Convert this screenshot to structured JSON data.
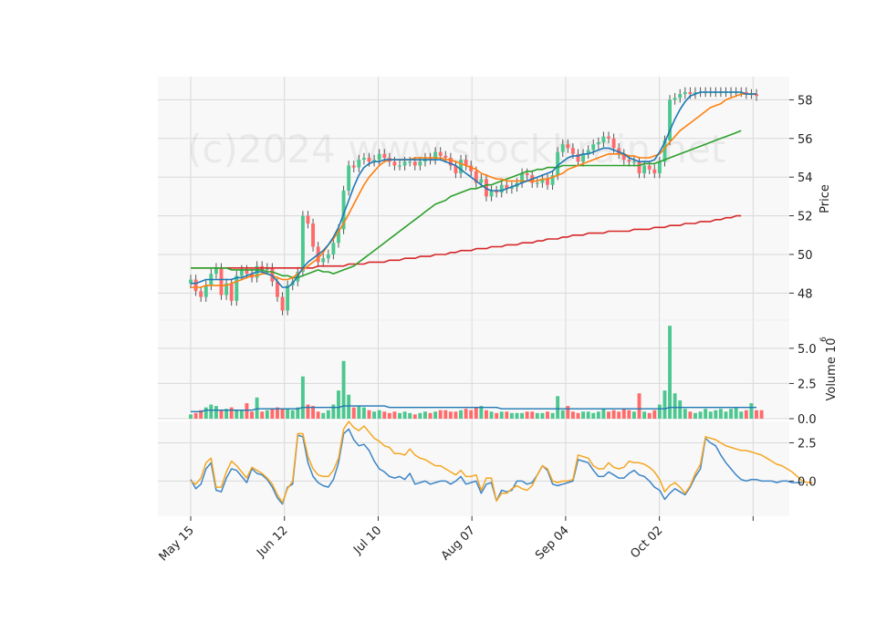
{
  "watermark": "(c)2024 www.stockbrain.net",
  "colors": {
    "up": "#26a69a",
    "up_fill": "#4dc790",
    "down": "#e8474b",
    "down_fill": "#ff6b6b",
    "ma_fast": "#1f77b4",
    "ma_mid": "#ff7f0e",
    "ma_slow": "#2ca02c",
    "ma_long": "#d62728",
    "vol_ma": "#1f77b4",
    "osc_a": "#3d85c6",
    "osc_b": "#f5a623",
    "panel_bg": "#f8f8f8",
    "grid": "#d9d9d9"
  },
  "chart_data": [
    {
      "type": "candlestick",
      "ylabel": "Price",
      "ylim": [
        46.6,
        59.2
      ],
      "yticks": [
        "48",
        "50",
        "52",
        "54",
        "56",
        "58"
      ],
      "ytick_values": [
        48,
        50,
        52,
        54,
        56,
        58
      ],
      "x_start": "2023-05-15",
      "x_end": "2023-10-31",
      "xtick_labels": [
        "May 15",
        "Jun 12",
        "Jul 10",
        "Aug 07",
        "Sep 04",
        "Oct 02"
      ],
      "xtick_dates": [
        "2023-05-15",
        "2023-06-12",
        "2023-07-10",
        "2023-08-07",
        "2023-09-04",
        "2023-10-02",
        "2023-10-30"
      ],
      "close": [
        48.7,
        48.1,
        47.8,
        48.4,
        49.0,
        49.3,
        47.9,
        48.5,
        47.6,
        48.9,
        49.2,
        49.0,
        48.8,
        49.4,
        49.2,
        49.3,
        48.6,
        47.8,
        47.1,
        48.4,
        48.6,
        49.1,
        52.0,
        51.6,
        50.4,
        49.6,
        49.8,
        50.0,
        50.6,
        51.3,
        53.3,
        54.6,
        54.5,
        54.9,
        55.0,
        54.8,
        54.9,
        55.2,
        55.0,
        54.8,
        54.6,
        54.6,
        54.8,
        54.8,
        54.6,
        54.8,
        55.0,
        54.9,
        55.3,
        55.1,
        55.0,
        54.6,
        54.2,
        54.9,
        54.6,
        54.3,
        53.7,
        53.9,
        53.0,
        53.3,
        53.2,
        53.6,
        53.4,
        53.5,
        53.7,
        54.2,
        54.1,
        53.7,
        53.7,
        53.9,
        53.6,
        54.1,
        55.3,
        55.7,
        55.5,
        55.2,
        54.8,
        55.2,
        55.4,
        55.7,
        55.8,
        56.1,
        56.0,
        55.5,
        55.2,
        54.9,
        54.8,
        54.8,
        54.2,
        54.6,
        54.4,
        54.2,
        54.8,
        55.9,
        58.0,
        58.1,
        58.3,
        58.4,
        58.3,
        58.4,
        58.4,
        58.4,
        58.4,
        58.4,
        58.4,
        58.4,
        58.4,
        58.4,
        58.4,
        58.3,
        58.3,
        58.2
      ],
      "ma_fast": [
        48.5,
        48.5,
        48.6,
        48.7,
        48.7,
        48.7,
        48.7,
        48.7,
        48.7,
        48.8,
        48.8,
        48.9,
        49.0,
        49.1,
        49.1,
        49.0,
        48.9,
        48.6,
        48.3,
        48.3,
        48.5,
        48.9,
        49.3,
        49.6,
        49.8,
        50.0,
        50.2,
        50.5,
        50.9,
        51.4,
        52.1,
        52.8,
        53.5,
        54.1,
        54.5,
        54.7,
        54.8,
        54.8,
        54.9,
        54.9,
        54.9,
        54.9,
        54.9,
        54.9,
        54.9,
        54.9,
        54.9,
        54.9,
        54.9,
        54.9,
        54.8,
        54.7,
        54.6,
        54.4,
        54.2,
        54.0,
        53.8,
        53.6,
        53.4,
        53.3,
        53.3,
        53.3,
        53.4,
        53.5,
        53.6,
        53.7,
        53.8,
        53.9,
        54.0,
        54.1,
        54.2,
        54.3,
        54.6,
        54.8,
        55.0,
        55.1,
        55.1,
        55.2,
        55.2,
        55.3,
        55.4,
        55.5,
        55.5,
        55.4,
        55.3,
        55.2,
        55.0,
        54.9,
        54.8,
        54.8,
        54.8,
        54.9,
        55.3,
        55.8,
        56.4,
        57.0,
        57.5,
        57.9,
        58.2,
        58.3,
        58.4,
        58.4,
        58.4,
        58.4,
        58.4,
        58.4,
        58.4,
        58.4,
        58.4,
        58.3,
        58.3,
        58.3
      ],
      "ma_mid": [
        48.3,
        48.3,
        48.3,
        48.4,
        48.4,
        48.4,
        48.4,
        48.4,
        48.5,
        48.6,
        48.7,
        48.8,
        48.9,
        48.9,
        49.0,
        49.0,
        48.9,
        48.8,
        48.7,
        48.7,
        48.8,
        49.0,
        49.2,
        49.4,
        49.6,
        49.8,
        50.1,
        50.5,
        50.8,
        51.2,
        51.6,
        52.1,
        52.6,
        53.1,
        53.6,
        54.0,
        54.3,
        54.6,
        54.8,
        54.9,
        54.9,
        54.9,
        54.9,
        54.9,
        55.0,
        55.0,
        55.0,
        55.0,
        55.0,
        55.0,
        54.9,
        54.9,
        54.8,
        54.7,
        54.6,
        54.5,
        54.4,
        54.2,
        54.1,
        54.0,
        53.9,
        53.9,
        53.8,
        53.8,
        53.8,
        53.8,
        53.8,
        53.8,
        53.8,
        53.9,
        53.9,
        54.0,
        54.1,
        54.2,
        54.4,
        54.5,
        54.6,
        54.7,
        54.8,
        54.9,
        55.0,
        55.1,
        55.2,
        55.2,
        55.2,
        55.2,
        55.1,
        55.1,
        55.0,
        55.0,
        55.0,
        55.1,
        55.2,
        55.5,
        55.8,
        56.1,
        56.4,
        56.6,
        56.8,
        57.0,
        57.2,
        57.4,
        57.6,
        57.7,
        57.8,
        58.0,
        58.1,
        58.2,
        58.3,
        58.3,
        58.3,
        58.3
      ],
      "ma_slow": [
        49.3,
        49.3,
        49.3,
        49.3,
        49.3,
        49.3,
        49.3,
        49.3,
        49.2,
        49.2,
        49.2,
        49.2,
        49.2,
        49.2,
        49.2,
        49.1,
        49.1,
        49.0,
        48.9,
        48.9,
        48.8,
        48.8,
        48.9,
        49.0,
        49.1,
        49.2,
        49.1,
        49.1,
        49.0,
        49.1,
        49.2,
        49.3,
        49.4,
        49.6,
        49.8,
        50.0,
        50.2,
        50.4,
        50.6,
        50.8,
        51.0,
        51.2,
        51.4,
        51.6,
        51.8,
        52.0,
        52.2,
        52.4,
        52.6,
        52.7,
        52.8,
        53.0,
        53.1,
        53.2,
        53.3,
        53.4,
        53.4,
        53.5,
        53.6,
        53.6,
        53.7,
        53.8,
        53.9,
        54.0,
        54.1,
        54.2,
        54.3,
        54.3,
        54.4,
        54.4,
        54.5,
        54.5,
        54.5,
        54.6,
        54.6,
        54.6,
        54.6,
        54.6,
        54.6,
        54.6,
        54.6,
        54.6,
        54.6,
        54.6,
        54.6,
        54.6,
        54.6,
        54.6,
        54.6,
        54.7,
        54.7,
        54.7,
        54.8,
        54.9,
        55.0,
        55.1,
        55.2,
        55.3,
        55.4,
        55.5,
        55.6,
        55.7,
        55.8,
        55.9,
        56.0,
        56.1,
        56.2,
        56.3,
        56.4
      ],
      "ma_long": [
        49.3,
        49.3,
        49.3,
        49.3,
        49.3,
        49.3,
        49.3,
        49.3,
        49.3,
        49.3,
        49.3,
        49.3,
        49.3,
        49.3,
        49.3,
        49.3,
        49.3,
        49.3,
        49.3,
        49.3,
        49.3,
        49.3,
        49.3,
        49.3,
        49.3,
        49.4,
        49.4,
        49.4,
        49.4,
        49.4,
        49.4,
        49.5,
        49.5,
        49.5,
        49.5,
        49.6,
        49.6,
        49.6,
        49.6,
        49.7,
        49.7,
        49.7,
        49.8,
        49.8,
        49.8,
        49.9,
        49.9,
        49.9,
        50.0,
        50.0,
        50.0,
        50.1,
        50.1,
        50.2,
        50.2,
        50.2,
        50.3,
        50.3,
        50.3,
        50.4,
        50.4,
        50.4,
        50.5,
        50.5,
        50.5,
        50.6,
        50.6,
        50.6,
        50.7,
        50.7,
        50.8,
        50.8,
        50.8,
        50.9,
        50.9,
        51.0,
        51.0,
        51.0,
        51.1,
        51.1,
        51.1,
        51.1,
        51.2,
        51.2,
        51.2,
        51.2,
        51.2,
        51.3,
        51.3,
        51.3,
        51.3,
        51.4,
        51.4,
        51.4,
        51.5,
        51.5,
        51.5,
        51.6,
        51.6,
        51.6,
        51.7,
        51.7,
        51.7,
        51.8,
        51.8,
        51.9,
        51.9,
        52.0,
        52.0
      ]
    },
    {
      "type": "bar",
      "ylabel": "Volume",
      "ylabel_exponent": "6",
      "ylim": [
        0,
        7.0
      ],
      "yticks": [
        "0.0",
        "2.5",
        "5.0"
      ],
      "ytick_values": [
        0,
        2.5,
        5.0
      ],
      "values": [
        0.3,
        0.4,
        0.6,
        0.8,
        1.0,
        0.9,
        0.6,
        0.7,
        0.8,
        0.6,
        0.6,
        1.1,
        0.5,
        1.5,
        0.5,
        0.6,
        0.7,
        0.8,
        0.7,
        0.7,
        0.6,
        0.8,
        3.0,
        1.0,
        0.9,
        0.5,
        0.4,
        0.6,
        1.0,
        2.0,
        4.1,
        1.7,
        0.8,
        0.9,
        0.8,
        0.6,
        0.5,
        0.6,
        0.5,
        0.4,
        0.5,
        0.4,
        0.5,
        0.4,
        0.3,
        0.4,
        0.5,
        0.4,
        0.5,
        0.6,
        0.6,
        0.5,
        0.5,
        0.6,
        0.7,
        0.6,
        0.8,
        0.9,
        0.6,
        0.5,
        0.4,
        0.5,
        0.5,
        0.4,
        0.4,
        0.4,
        0.5,
        0.5,
        0.4,
        0.4,
        0.5,
        0.4,
        1.6,
        0.6,
        0.9,
        0.5,
        0.4,
        0.5,
        0.5,
        0.4,
        0.5,
        0.7,
        0.5,
        0.6,
        0.5,
        0.7,
        0.6,
        0.5,
        1.8,
        0.5,
        0.4,
        0.6,
        1.0,
        2.0,
        6.6,
        1.8,
        1.3,
        0.7,
        0.5,
        0.4,
        0.5,
        0.7,
        0.5,
        0.6,
        0.7,
        0.5,
        0.7,
        0.8,
        0.5,
        0.6,
        1.1,
        0.6,
        0.6
      ],
      "ma": [
        0.5,
        0.5,
        0.5,
        0.6,
        0.6,
        0.6,
        0.6,
        0.6,
        0.6,
        0.6,
        0.6,
        0.6,
        0.6,
        0.7,
        0.7,
        0.7,
        0.7,
        0.7,
        0.7,
        0.7,
        0.7,
        0.7,
        0.8,
        0.8,
        0.8,
        0.8,
        0.8,
        0.8,
        0.8,
        0.8,
        0.9,
        0.9,
        0.9,
        0.9,
        0.9,
        0.9,
        0.9,
        0.9,
        0.9,
        0.8,
        0.8,
        0.8,
        0.8,
        0.8,
        0.8,
        0.8,
        0.8,
        0.8,
        0.8,
        0.8,
        0.8,
        0.8,
        0.8,
        0.8,
        0.8,
        0.8,
        0.8,
        0.8,
        0.8,
        0.8,
        0.8,
        0.7,
        0.7,
        0.7,
        0.7,
        0.7,
        0.7,
        0.7,
        0.7,
        0.7,
        0.7,
        0.7,
        0.7,
        0.7,
        0.7,
        0.7,
        0.7,
        0.7,
        0.7,
        0.7,
        0.7,
        0.7,
        0.7,
        0.7,
        0.7,
        0.7,
        0.7,
        0.7,
        0.7,
        0.7,
        0.7,
        0.7,
        0.7,
        0.7,
        0.8,
        0.8,
        0.8,
        0.8,
        0.8,
        0.8,
        0.8,
        0.8,
        0.8,
        0.8,
        0.8,
        0.8,
        0.8,
        0.8,
        0.8,
        0.8,
        0.8,
        0.8
      ]
    },
    {
      "type": "line",
      "ylim": [
        -2.3,
        3.9
      ],
      "yticks": [
        "0.0",
        "2.5"
      ],
      "ytick_values": [
        0,
        2.5
      ],
      "series": [
        {
          "values": [
            0.1,
            -0.5,
            -0.2,
            0.8,
            1.2,
            -0.6,
            -0.7,
            0.2,
            0.8,
            0.7,
            0.3,
            -0.1,
            0.8,
            0.5,
            0.4,
            0.1,
            -0.4,
            -1.1,
            -1.5,
            -0.4,
            -0.2,
            3.0,
            2.9,
            1.2,
            0.3,
            -0.1,
            -0.3,
            -0.4,
            0.1,
            1.2,
            3.1,
            3.4,
            2.7,
            2.3,
            2.4,
            2.0,
            1.3,
            0.8,
            0.6,
            0.3,
            0.2,
            0.3,
            0.1,
            0.5,
            -0.2,
            -0.1,
            0.0,
            -0.2,
            -0.1,
            0.0,
            0.0,
            -0.2,
            0.0,
            0.3,
            -0.2,
            -0.1,
            0.0,
            -0.8,
            -0.2,
            -0.1,
            -1.3,
            -0.6,
            -0.7,
            -0.6,
            0.0,
            0.0,
            -0.2,
            -0.1,
            0.4,
            1.0,
            0.7,
            -0.2,
            -0.3,
            -0.2,
            -0.1,
            0.0,
            1.4,
            1.3,
            1.2,
            0.7,
            0.3,
            0.3,
            0.6,
            0.4,
            0.2,
            0.2,
            0.5,
            0.7,
            0.4,
            0.3,
            0.0,
            -0.4,
            -0.6,
            -1.2,
            -0.8,
            -0.5,
            -0.7,
            -0.9,
            -0.4,
            0.3,
            0.8,
            2.8,
            2.5,
            2.3,
            1.7,
            1.2,
            0.8,
            0.4,
            0.1,
            0.0,
            0.1,
            0.1,
            0.0,
            0.0,
            0.0,
            -0.1,
            0.0,
            0.0,
            -0.1,
            -0.1,
            -0.1
          ]
        },
        {
          "values": [
            0.0,
            -0.2,
            0.2,
            1.2,
            1.5,
            -0.4,
            -0.4,
            0.6,
            1.3,
            1.0,
            0.6,
            0.2,
            0.9,
            0.7,
            0.5,
            0.2,
            -0.2,
            -0.9,
            -1.4,
            -0.5,
            0.0,
            3.1,
            3.1,
            1.6,
            0.8,
            0.4,
            0.3,
            0.3,
            0.7,
            1.5,
            3.4,
            3.9,
            3.5,
            3.3,
            3.6,
            3.2,
            2.8,
            2.6,
            2.3,
            2.2,
            1.8,
            1.8,
            1.7,
            2.1,
            1.7,
            1.5,
            1.4,
            1.2,
            1.0,
            1.0,
            0.8,
            0.6,
            0.4,
            0.7,
            0.3,
            0.3,
            0.4,
            -0.6,
            0.2,
            0.2,
            -1.3,
            -0.8,
            -0.8,
            -0.5,
            -0.3,
            -0.5,
            -0.6,
            -0.3,
            0.4,
            1.0,
            0.8,
            0.0,
            -0.1,
            0.0,
            0.0,
            0.1,
            1.7,
            1.6,
            1.5,
            1.0,
            0.8,
            0.8,
            1.2,
            0.9,
            0.8,
            0.9,
            1.3,
            1.2,
            1.2,
            1.1,
            0.9,
            0.6,
            0.1,
            -0.7,
            -0.3,
            -0.1,
            -0.4,
            -0.8,
            -0.3,
            0.5,
            1.1,
            2.9,
            2.8,
            2.7,
            2.5,
            2.3,
            2.2,
            2.1,
            2.0,
            2.0,
            1.9,
            1.8,
            1.7,
            1.5,
            1.3,
            1.1,
            1.0,
            0.8,
            0.6,
            0.3,
            0.0,
            -0.1,
            -0.1
          ]
        }
      ]
    }
  ]
}
